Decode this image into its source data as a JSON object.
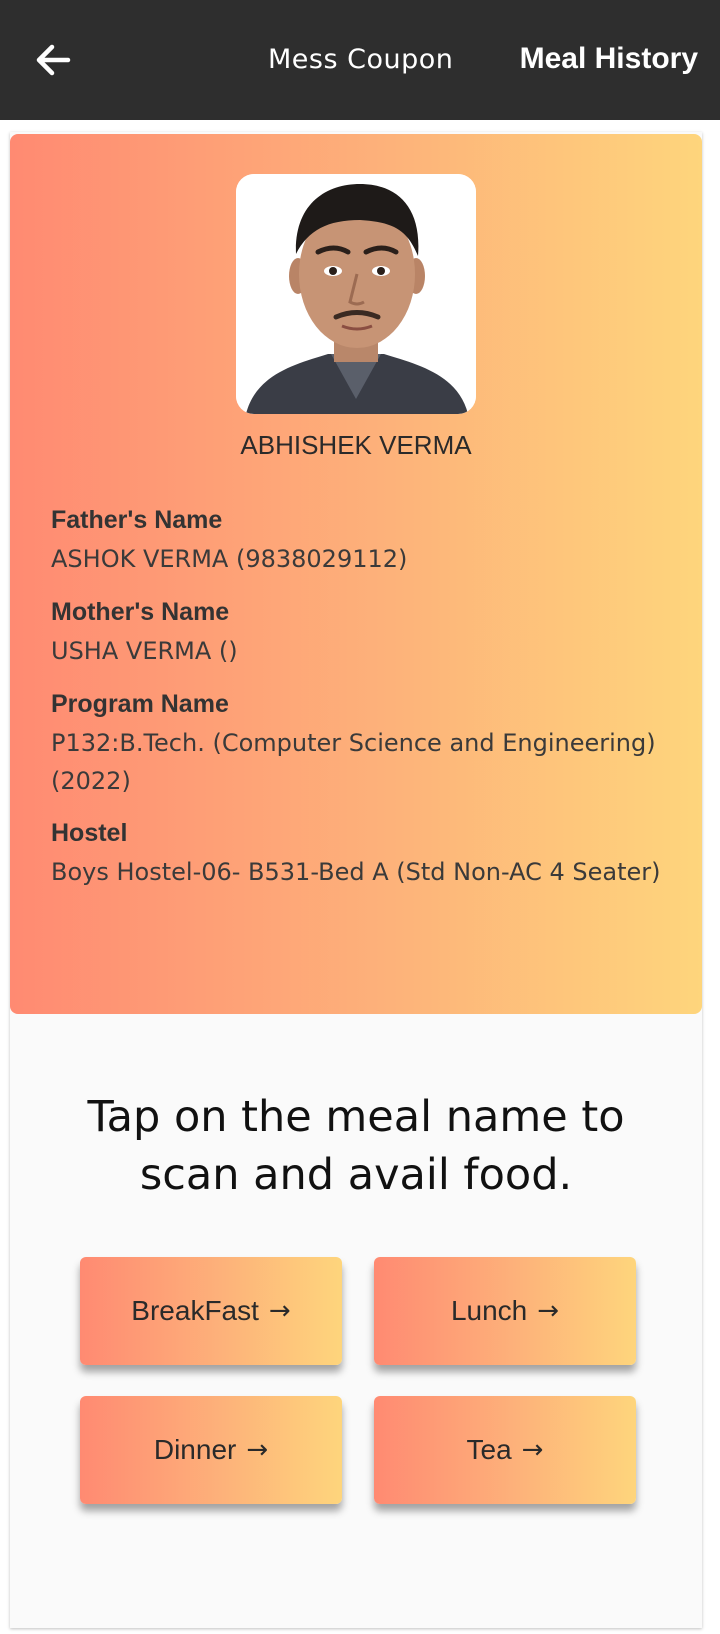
{
  "appbar": {
    "title": "Mess Coupon",
    "action_label": "Meal History"
  },
  "profile": {
    "name": "ABHISHEK VERMA",
    "fields": [
      {
        "label": "Father's Name",
        "value": "ASHOK VERMA (9838029112)"
      },
      {
        "label": "Mother's Name",
        "value": "USHA VERMA ()"
      },
      {
        "label": "Program Name",
        "value": "P132:B.Tech. (Computer Science and Engineering) (2022)"
      },
      {
        "label": "Hostel",
        "value": "Boys Hostel-06- B531-Bed A (Std Non-AC 4 Seater)"
      }
    ]
  },
  "instruction": "Tap on the meal name to scan and avail food.",
  "meals": [
    {
      "label": "BreakFast",
      "arrow": "→"
    },
    {
      "label": "Lunch",
      "arrow": "→"
    },
    {
      "label": "Dinner",
      "arrow": "→"
    },
    {
      "label": "Tea",
      "arrow": "→"
    }
  ],
  "colors": {
    "appbar": "#2e2e2e",
    "gradient_start": "#ff8a72",
    "gradient_end": "#fed57c"
  },
  "icons": {
    "back": "arrow-left-icon"
  }
}
